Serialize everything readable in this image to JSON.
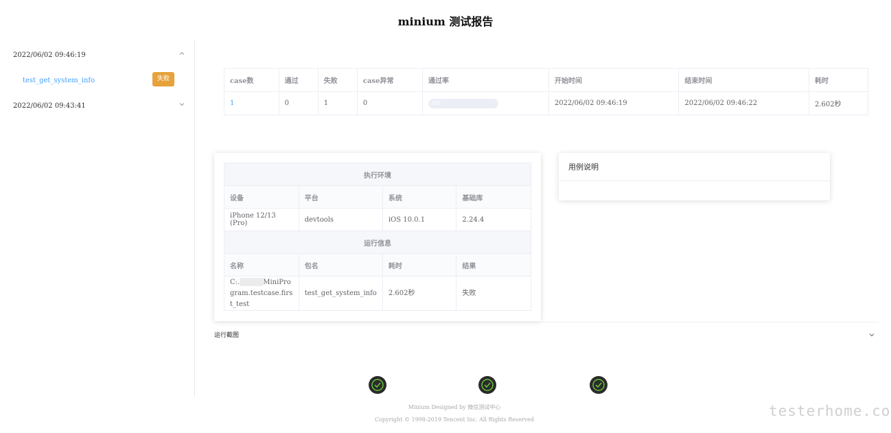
{
  "page": {
    "title": "minium 测试报告"
  },
  "sidebar": {
    "runs": [
      {
        "date": "2022/06/02 09:46:19",
        "expanded": true,
        "cases": [
          {
            "name": "test_get_system_info",
            "status": "失败"
          }
        ]
      },
      {
        "date": "2022/06/02 09:43:41",
        "expanded": false,
        "cases": []
      }
    ]
  },
  "summary": {
    "headers": [
      "case数",
      "通过",
      "失败",
      "case异常",
      "通过率",
      "开始时间",
      "结束时间",
      "耗时"
    ],
    "values": {
      "case_count": "1",
      "passed": "0",
      "failed": "1",
      "errors": "0",
      "pass_rate_percent": 0,
      "pass_rate_text": "0%",
      "start_time": "2022/06/02 09:46:19",
      "end_time": "2022/06/02 09:46:22",
      "duration": "2.602秒"
    }
  },
  "env": {
    "env_title": "执行环境",
    "env_headers": [
      "设备",
      "平台",
      "系统",
      "基础库"
    ],
    "env_values": [
      "iPhone 12/13 (Pro)",
      "devtools",
      "iOS 10.0.1",
      "2.24.4"
    ],
    "run_title": "运行信息",
    "run_headers": [
      "名称",
      "包名",
      "耗时",
      "结果"
    ],
    "run_values": {
      "name_prefix": "C:.",
      "name_suffix": "MiniProgram.testcase.first_test",
      "package": "test_get_system_info",
      "duration": "2.602秒",
      "result": "失败"
    }
  },
  "description": {
    "title": "用例说明"
  },
  "screenshots": {
    "label": "运行截图"
  },
  "footer": {
    "line1": "Minium Designed by 微信测试中心",
    "line2": "Copyright © 1998-2019 Tencent Inc. All Rights Reserved"
  },
  "watermark": "testerhome.com",
  "colors": {
    "fail_badge": "#e6a23c",
    "link": "#409eff",
    "pass": "#67c23a"
  }
}
